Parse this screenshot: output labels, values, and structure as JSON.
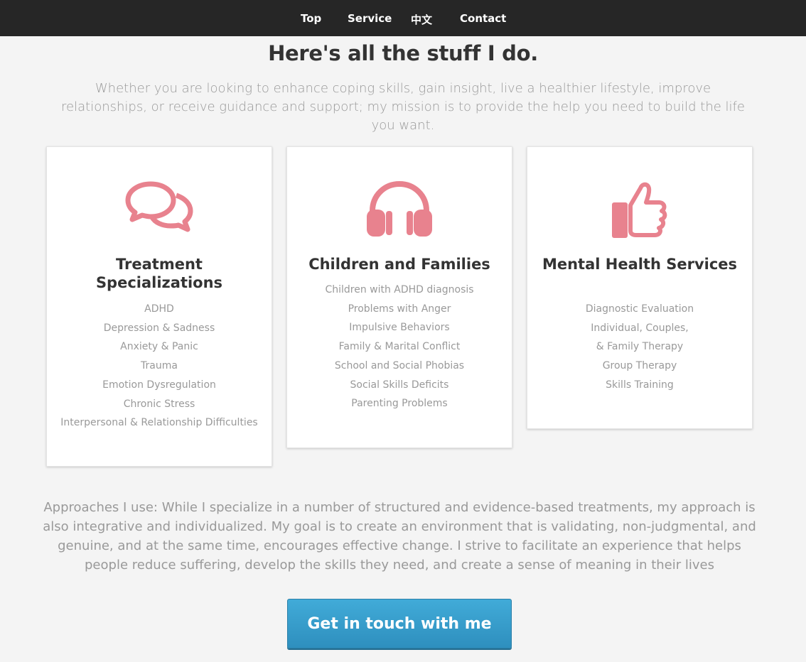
{
  "nav": {
    "items": [
      "Top",
      "Service",
      "中文",
      "Contact"
    ]
  },
  "heading": "Here's all the stuff I do.",
  "intro": "Whether you are looking to enhance coping skills, gain insight, live a healthier lifestyle, improve relationships, or receive guidance and support; my mission is to provide the help you need to build the life you want.",
  "accent_color": "#e8828e",
  "cards": [
    {
      "icon": "speech-bubbles-icon",
      "title": "Treatment Specializations",
      "items": [
        "ADHD",
        "Depression & Sadness",
        "Anxiety & Panic",
        "Trauma",
        "Emotion Dysregulation",
        "Chronic Stress",
        "Interpersonal & Relationship Difficulties"
      ]
    },
    {
      "icon": "headphones-icon",
      "title": "Children and Families",
      "items": [
        "Children with ADHD diagnosis",
        "Problems with Anger",
        "Impulsive Behaviors",
        "Family & Marital Conflict",
        "School and Social Phobias",
        "Social Skills Deficits",
        "Parenting Problems"
      ]
    },
    {
      "icon": "thumbs-up-icon",
      "title": "Mental Health Services",
      "items": [
        "Diagnostic Evaluation",
        "Individual, Couples,",
        "& Family Therapy",
        "Group Therapy",
        "Skills Training"
      ]
    }
  ],
  "approach": "Approaches I use: While I specialize in a number of structured and evidence-based treatments, my approach is also integrative and individualized. My goal is to create an environment that is validating, non-judgmental, and genuine, and at the same time, encourages effective change. I strive to facilitate an experience that helps people reduce suffering, develop the skills they need, and create a sense of meaning in their lives",
  "cta_label": "Get in touch with me"
}
